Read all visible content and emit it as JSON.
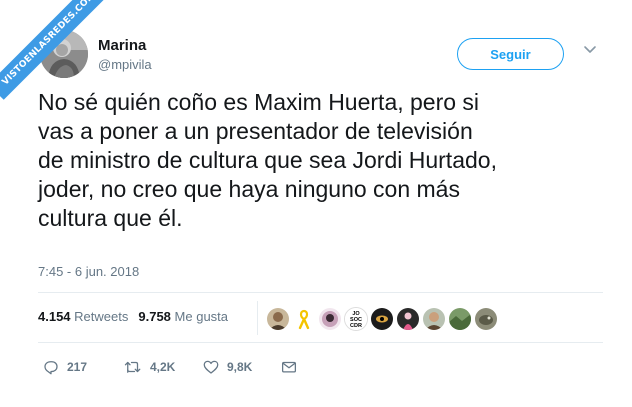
{
  "watermark": {
    "text": "VISTOENLASREDES.COM"
  },
  "user": {
    "name": "Marina",
    "handle": "@mpivila"
  },
  "follow": {
    "label": "Seguir"
  },
  "tweet": {
    "text": "No sé quién coño es Maxim Huerta, pero si\nvas a poner a un presentador de televisión\nde ministro de cultura que sea Jordi Hurtado,\njoder, no creo que haya ninguno con más\ncultura que él.",
    "timestamp": "7:45 - 6 jun. 2018"
  },
  "stats": {
    "retweets_count": "4.154",
    "retweets_label": "Retweets",
    "likes_count": "9.758",
    "likes_label": "Me gusta"
  },
  "likers": [
    {
      "icon": "portrait-man",
      "color": "#4a3b2c"
    },
    {
      "icon": "yellow-ribbon",
      "color": "#f4c400"
    },
    {
      "icon": "bust-portrait",
      "color": "#c6a0b8"
    },
    {
      "icon": "jo-soc-cdr-text",
      "text": [
        "JO",
        "SOC",
        "CDR"
      ],
      "color": "#ffffff"
    },
    {
      "icon": "dark-eye",
      "color": "#1b1b1b"
    },
    {
      "icon": "pink-figure",
      "color": "#e45a8c"
    },
    {
      "icon": "portrait-man",
      "color": "#5b4632"
    },
    {
      "icon": "green-landscape",
      "color": "#4a6a3a"
    },
    {
      "icon": "grey-animal",
      "color": "#5a5a48"
    }
  ],
  "actions": {
    "reply": {
      "icon": "reply-icon",
      "count": "217"
    },
    "retweet": {
      "icon": "retweet-icon",
      "count": "4,2K"
    },
    "like": {
      "icon": "heart-icon",
      "count": "9,8K"
    },
    "dm": {
      "icon": "envelope-icon"
    }
  },
  "colors": {
    "accent": "#1da1f2",
    "muted": "#657786",
    "text": "#14171a",
    "divider": "#e6ecf0",
    "watermark": "#3e9be5"
  }
}
